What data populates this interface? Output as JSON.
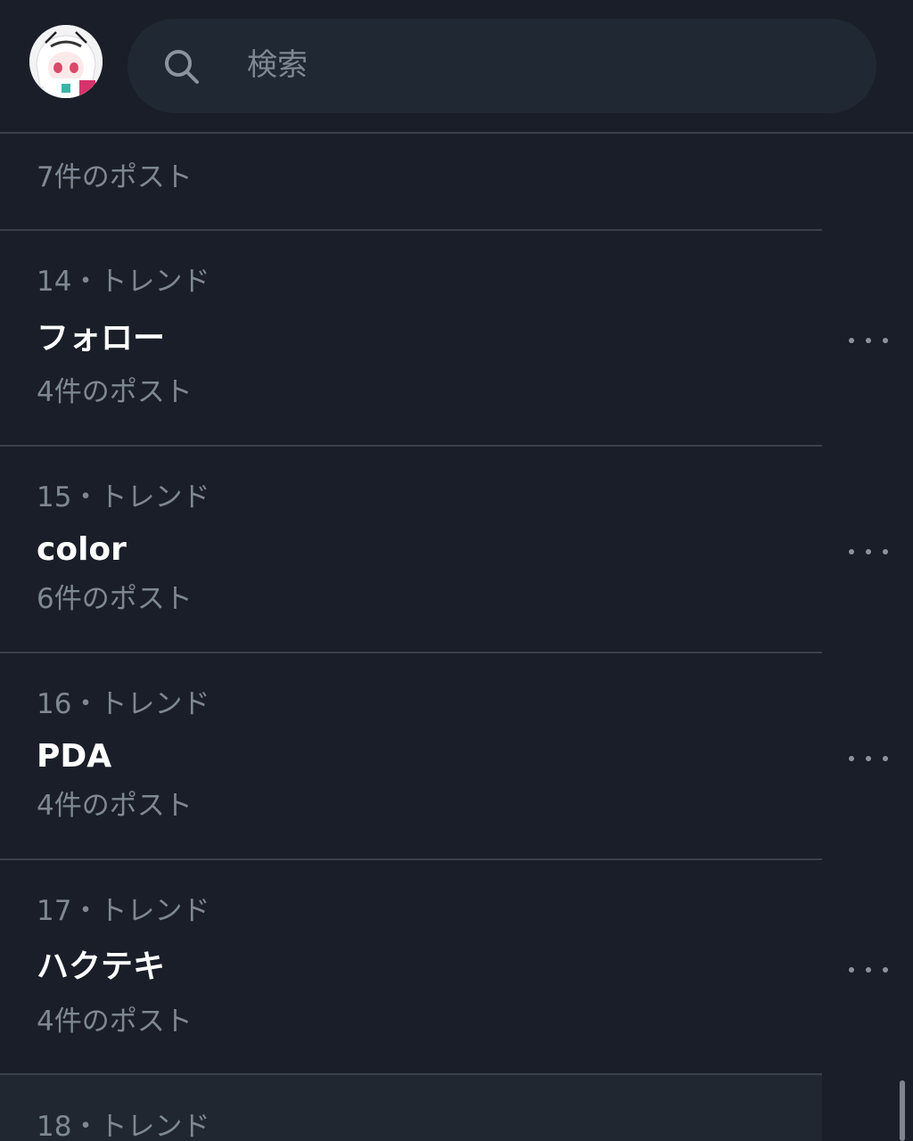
{
  "search": {
    "placeholder": "検索",
    "icon": "search-icon"
  },
  "trends": [
    {
      "rank_label": "",
      "term": "",
      "count": "7件のポスト"
    },
    {
      "rank_label": "14・トレンド",
      "term": "フォロー",
      "count": "4件のポスト"
    },
    {
      "rank_label": "15・トレンド",
      "term": "color",
      "count": "6件のポスト"
    },
    {
      "rank_label": "16・トレンド",
      "term": "PDA",
      "count": "4件のポスト"
    },
    {
      "rank_label": "17・トレンド",
      "term": "ハクテキ",
      "count": "4件のポスト"
    },
    {
      "rank_label": "18・トレンド",
      "term": "",
      "count": ""
    }
  ],
  "colors": {
    "background": "#1a1e28",
    "search_background": "#202833",
    "secondary_text": "#7e8893",
    "divider": "#3a4049"
  }
}
